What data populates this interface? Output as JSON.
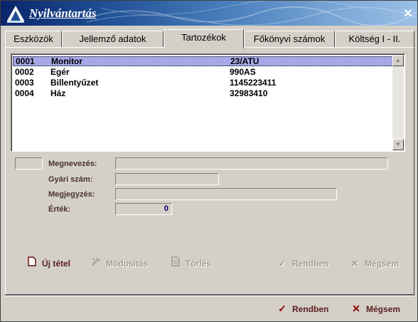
{
  "window": {
    "title": "Nyilvántartás",
    "close": "✕"
  },
  "tabs": [
    {
      "label": "Eszközök"
    },
    {
      "label": "Jellemző adatok"
    },
    {
      "label": "Tartozékok",
      "active": true
    },
    {
      "label": "Főkönyvi számok"
    },
    {
      "label": "Költség I - II."
    }
  ],
  "list": {
    "rows": [
      {
        "code": "0001",
        "name": "Monitor",
        "serial": "23/ATU",
        "selected": true
      },
      {
        "code": "0002",
        "name": "Egér",
        "serial": "990AS"
      },
      {
        "code": "0003",
        "name": "Billentyűzet",
        "serial": "1145223411"
      },
      {
        "code": "0004",
        "name": "Ház",
        "serial": "32983410"
      }
    ],
    "scroll_up": "▲",
    "scroll_down": "▼"
  },
  "form": {
    "name_label": "Megnevezés:",
    "serial_label": "Gyári szám:",
    "note_label": "Megjegyzés:",
    "value_label": "Érték:",
    "value": "0"
  },
  "actions": {
    "new_label": "Új tétel",
    "modify_label": "Módosítás",
    "delete_label": "Törlés",
    "ok_label": "Rendben",
    "cancel_label": "Mégsem"
  },
  "footer": {
    "ok_label": "Rendben",
    "cancel_label": "Mégsem"
  },
  "colors": {
    "selection": "#a6a8e8",
    "title_start": "#0a246a",
    "title_end": "#9cc0e6",
    "value_text": "#000080"
  }
}
